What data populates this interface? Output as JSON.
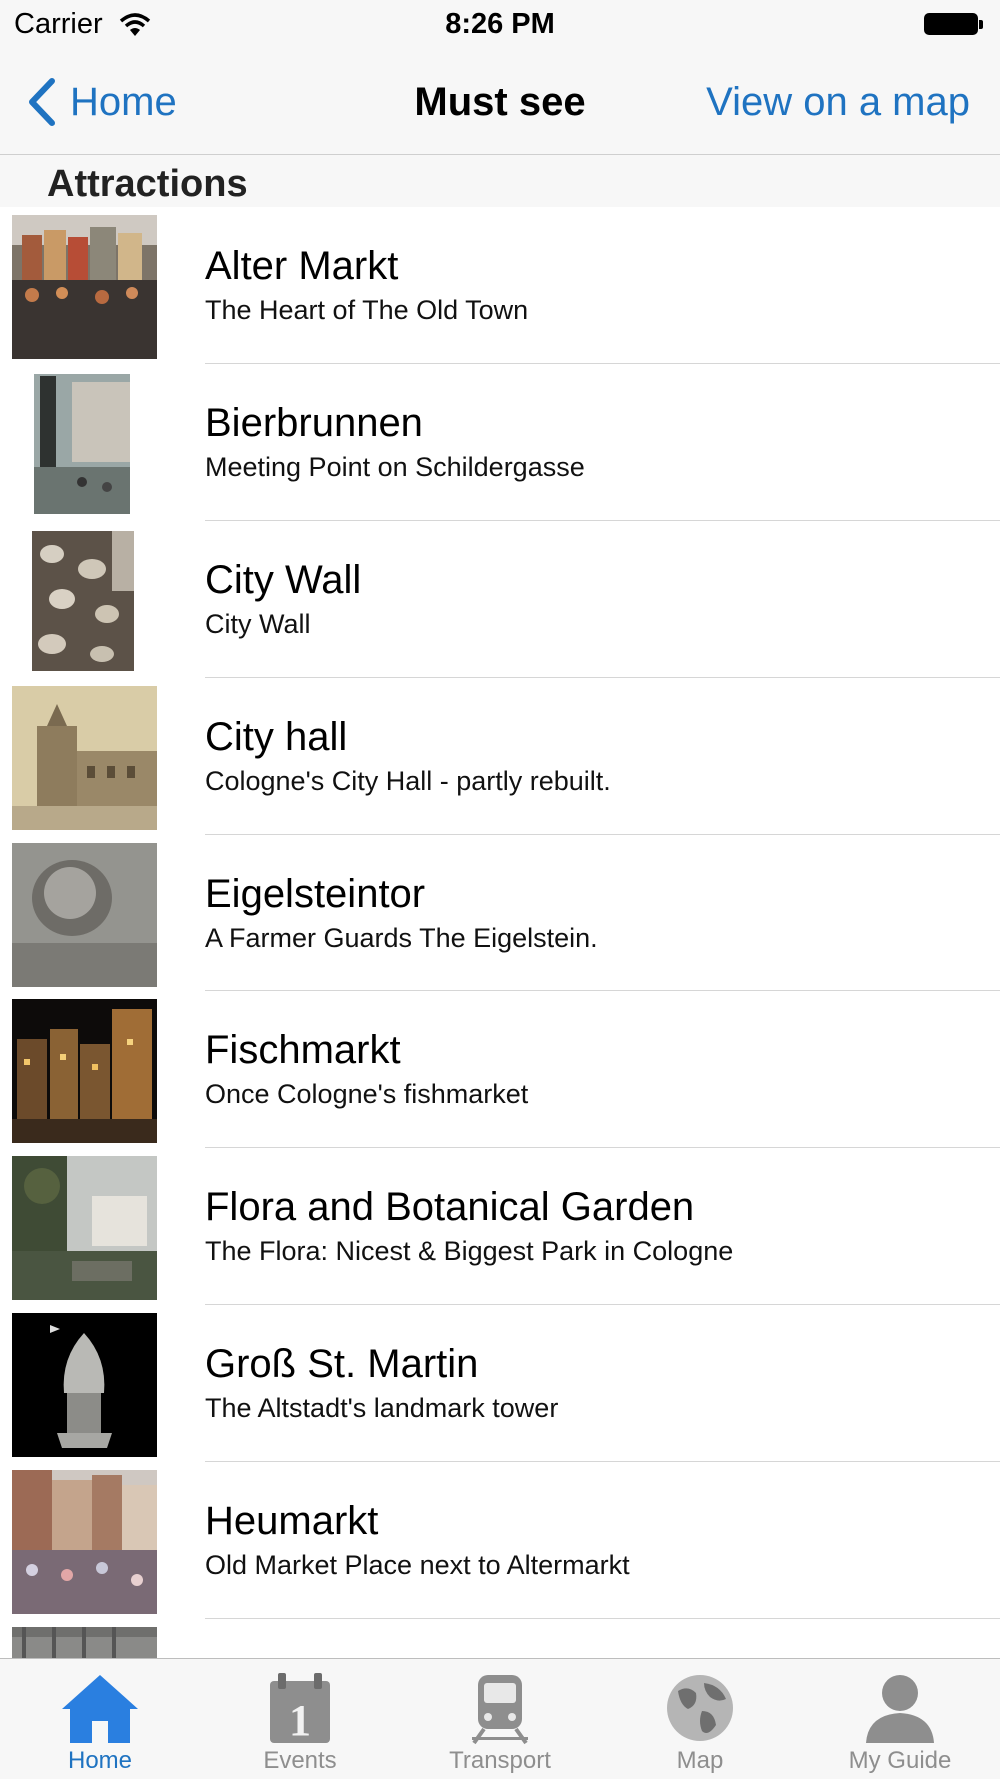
{
  "status_bar": {
    "carrier": "Carrier",
    "time": "8:26 PM"
  },
  "nav": {
    "back_label": "Home",
    "title": "Must see",
    "right_label": "View on a map"
  },
  "section": {
    "title": "Attractions"
  },
  "items": [
    {
      "title": "Alter Markt",
      "subtitle": "The Heart of The Old Town"
    },
    {
      "title": "Bierbrunnen",
      "subtitle": "Meeting Point on Schildergasse"
    },
    {
      "title": "City Wall",
      "subtitle": "City Wall"
    },
    {
      "title": "City hall",
      "subtitle": "Cologne's City Hall - partly rebuilt."
    },
    {
      "title": "Eigelsteintor",
      "subtitle": "A Farmer Guards The Eigelstein."
    },
    {
      "title": "Fischmarkt",
      "subtitle": "Once Cologne's fishmarket"
    },
    {
      "title": "Flora and Botanical Garden",
      "subtitle": "The Flora: Nicest & Biggest Park in Cologne"
    },
    {
      "title": "Groß St. Martin",
      "subtitle": "The Altstadt's landmark tower"
    },
    {
      "title": "Heumarkt",
      "subtitle": "Old Market Place next to Altermarkt"
    }
  ],
  "tabs": [
    {
      "label": "Home",
      "icon": "home-icon",
      "active": true
    },
    {
      "label": "Events",
      "icon": "calendar-icon",
      "active": false
    },
    {
      "label": "Transport",
      "icon": "train-icon",
      "active": false
    },
    {
      "label": "Map",
      "icon": "globe-icon",
      "active": false
    },
    {
      "label": "My Guide",
      "icon": "person-icon",
      "active": false
    }
  ],
  "colors": {
    "accent": "#1f73c1",
    "inactive_tab": "#8e8e8e",
    "bar_background": "#f7f7f7"
  }
}
